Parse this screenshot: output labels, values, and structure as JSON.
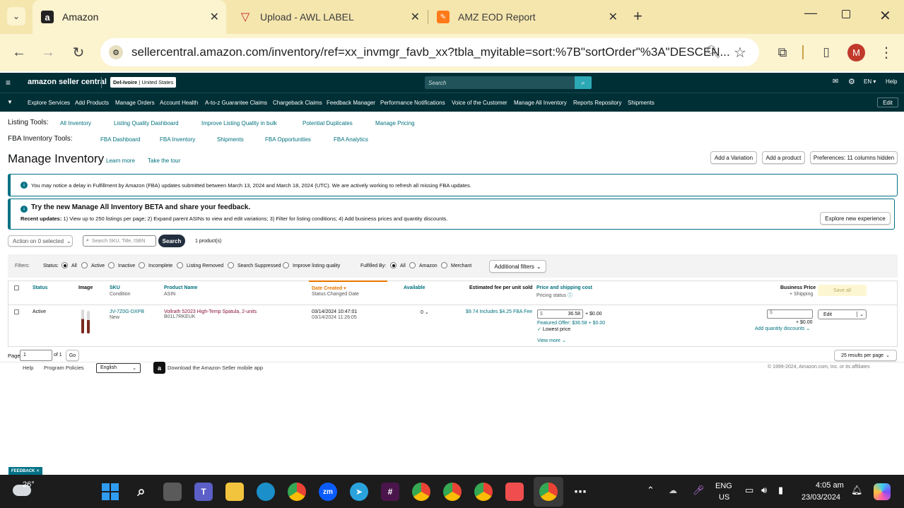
{
  "browser": {
    "tabs": [
      {
        "label": "Amazon",
        "icon": "amazon-icon"
      },
      {
        "label": "Upload - AWL LABEL",
        "icon": "awl-icon"
      },
      {
        "label": "AMZ EOD Report",
        "icon": "report-icon"
      }
    ],
    "url": "sellercentral.amazon.com/inventory/ref=xx_invmgr_favb_xx?tbla_myitable=sort:%7B\"sortOrder\"%3A\"DESCEN...",
    "profile_initial": "M"
  },
  "header": {
    "logo": "amazon seller central",
    "store": "Del-Ivoire",
    "region": "United States",
    "search_placeholder": "Search",
    "lang": "EN",
    "help": "Help"
  },
  "nav": [
    "Explore Services",
    "Add Products",
    "Manage Orders",
    "Account Health",
    "A-to-z Guarantee Claims",
    "Chargeback Claims",
    "Feedback Manager",
    "Performance Notifications",
    "Voice of the Customer",
    "Manage All Inventory",
    "Reports Repository",
    "Shipments"
  ],
  "nav_edit": "Edit",
  "listing_tools": {
    "label": "Listing Tools:",
    "links": [
      "All Inventory",
      "Listing Quality Dashboard",
      "Improve Listing Quality in bulk",
      "Potential Duplicates",
      "Manage Pricing"
    ]
  },
  "fba_tools": {
    "label": "FBA Inventory Tools:",
    "links": [
      "FBA Dashboard",
      "FBA Inventory",
      "Shipments",
      "FBA Opportunities",
      "FBA Analytics"
    ]
  },
  "page": {
    "title": "Manage Inventory",
    "learn_more": "Learn more",
    "tour": "Take the tour",
    "add_variation": "Add a Variation",
    "add_product": "Add a product",
    "preferences": "Preferences: 11 columns hidden"
  },
  "alert1": "You may notice a delay in Fulfillment by Amazon (FBA) updates submitted between March 13, 2024 and March 18, 2024 (UTC). We are actively working to refresh all missing FBA updates.",
  "beta": {
    "title": "Try the new Manage All Inventory BETA and share your feedback.",
    "recent_label": "Recent updates:",
    "recent_text": "1) View up to 250 listings per page; 2) Expand parent ASINs to view and edit variations; 3) Filter for listing conditions; 4) Add business prices and quantity discounts.",
    "explore": "Explore new experience"
  },
  "actions": {
    "action": "Action on 0 selected",
    "search_placeholder": "Search SKU, Title, ISBN",
    "search_btn": "Search",
    "count": "1 product(s)"
  },
  "filters": {
    "label": "Filters:",
    "status_label": "Status:",
    "status": [
      "All",
      "Active",
      "Inactive",
      "Incomplete",
      "Listing Removed",
      "Search Suppressed",
      "Improve listing quality"
    ],
    "fulfilled_label": "Fulfilled By:",
    "fulfilled": [
      "All",
      "Amazon",
      "Merchant"
    ],
    "additional": "Additional filters"
  },
  "table": {
    "headers": {
      "status": "Status",
      "image": "Image",
      "sku": "SKU",
      "sku_sub": "Condition",
      "product": "Product Name",
      "product_sub": "ASIN",
      "date": "Date Created",
      "date_sub": "Status Changed Date",
      "available": "Available",
      "fee": "Estimated fee per unit sold",
      "price": "Price and shipping cost",
      "price_sub": "Pricing status",
      "business": "Business Price",
      "business_sub": "+ Shipping",
      "save_all": "Save all"
    },
    "row": {
      "status": "Active",
      "sku": "JV-7Z0G-DXPB",
      "condition": "New",
      "product": "Vollrath 52023 High-Temp Spatula, 2-units",
      "asin": "B01L7RKEUK",
      "created": "03/14/2024 10:47:01",
      "changed": "03/14/2024 11:26:05",
      "available": "0",
      "fee": "$9.74 Includes $4.25 FBA Fee",
      "price": "36.58",
      "shipping": "+ $0.00",
      "featured": "Featured Offer: $36.58 + $0.00",
      "lowest": "Lowest price",
      "view_more": "View more",
      "biz_ship": "+ $0.00",
      "qty_discounts": "Add quantity discounts",
      "edit": "Edit",
      "currency": "$"
    }
  },
  "pagination": {
    "page_label": "Page",
    "page_value": "1",
    "of": "of 1",
    "go": "Go",
    "per_page": "25 results per page"
  },
  "footer": {
    "help": "Help",
    "policies": "Program Policies",
    "language": "English",
    "app": "Download the Amazon Seller mobile app",
    "copyright": "© 1999-2024, Amazon.com, Inc. or its affiliates"
  },
  "feedback": "FEEDBACK",
  "taskbar": {
    "temp": "26°",
    "lang1": "ENG",
    "lang2": "US",
    "time": "4:05 am",
    "date": "23/03/2024"
  }
}
